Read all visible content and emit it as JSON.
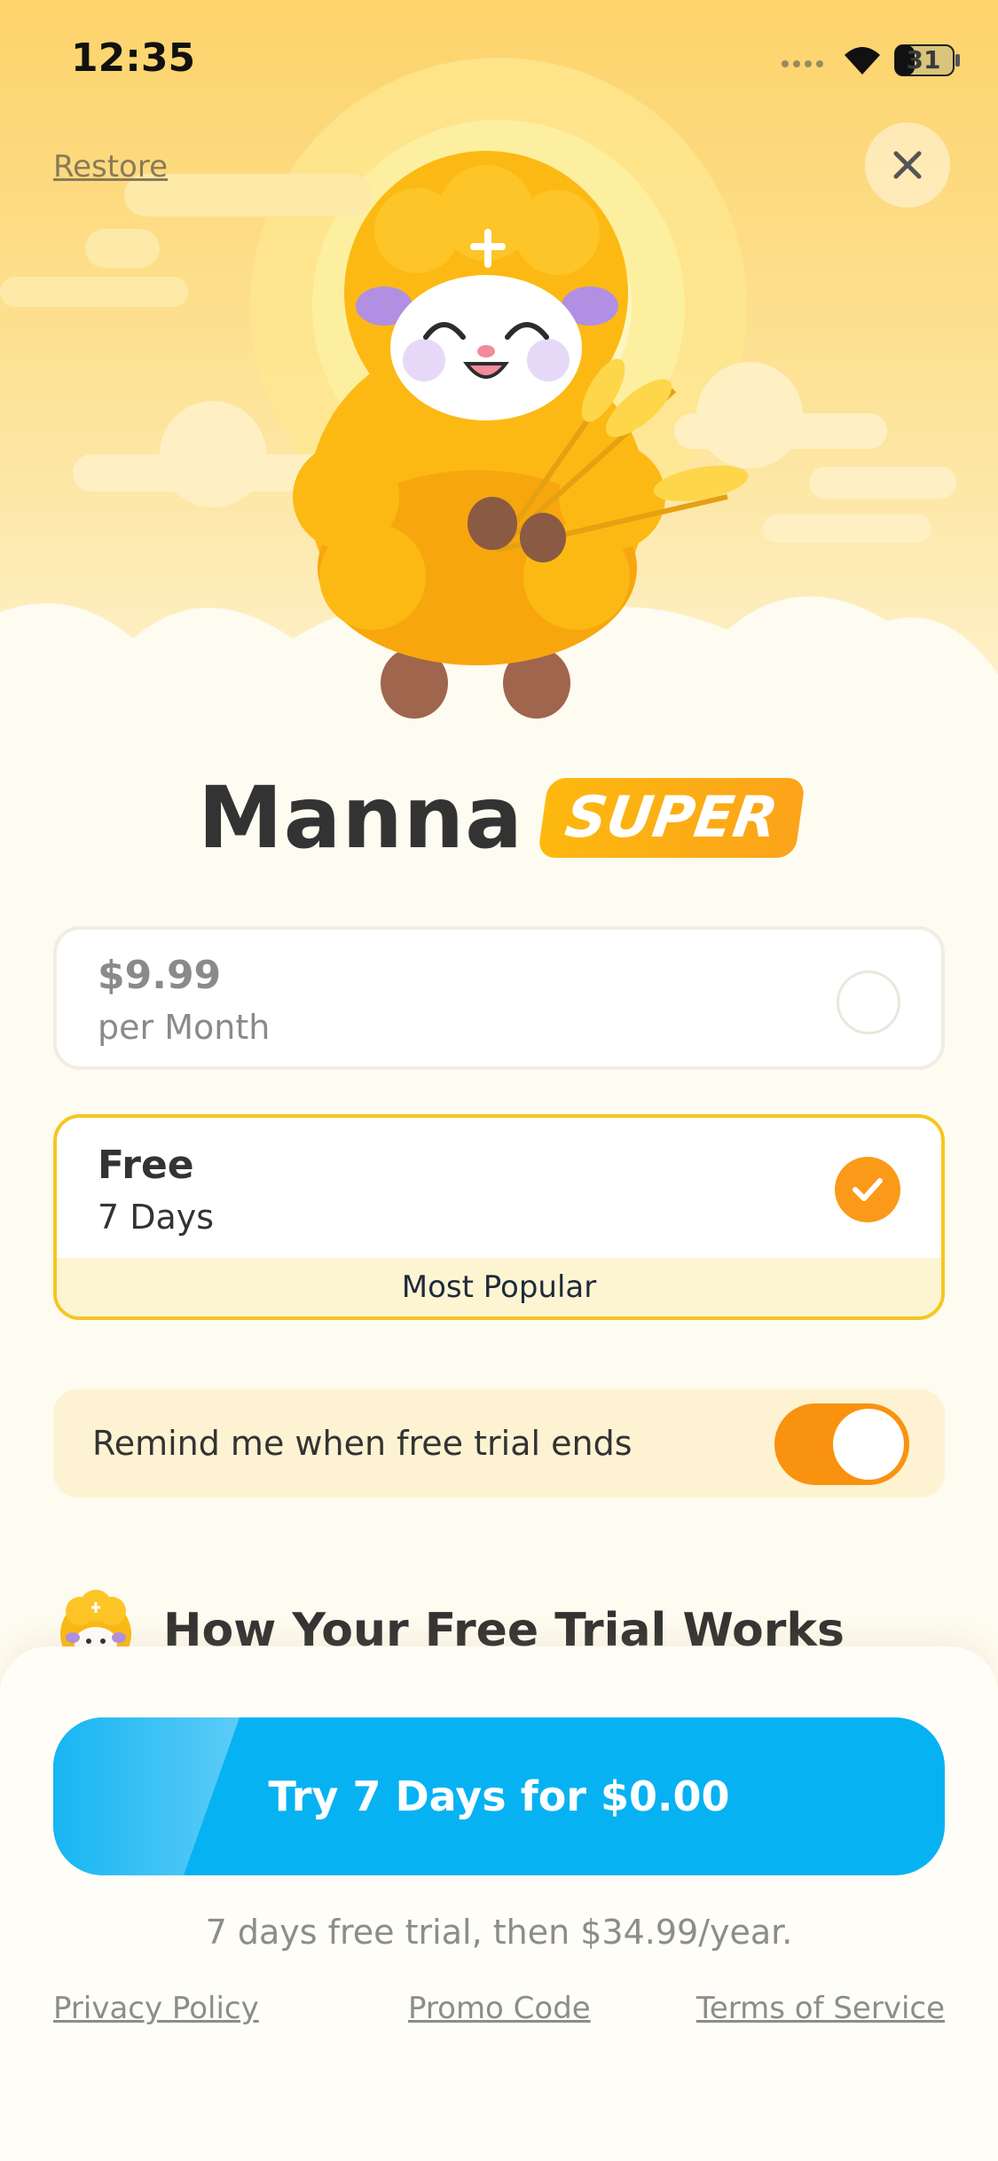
{
  "status_bar": {
    "time": "12:35",
    "battery": "31",
    "icons": [
      "signal-icon",
      "wifi-icon",
      "battery-icon"
    ]
  },
  "header": {
    "restore_label": "Restore",
    "close_icon": "close-icon"
  },
  "brand": {
    "app_name": "Manna",
    "badge": "SUPER",
    "accent": "#fcae14"
  },
  "plans": [
    {
      "price": "$9.99",
      "period": "per Month",
      "selected": false
    },
    {
      "price": "Free",
      "period": "7 Days",
      "selected": true,
      "tag": "Most Popular"
    }
  ],
  "reminder": {
    "label": "Remind me when free trial ends",
    "enabled": true
  },
  "how_it_works": {
    "title": "How Your Free Trial Works"
  },
  "cta": {
    "label": "Try 7 Days for $0.00",
    "color": "#07b2f2"
  },
  "trial_note": "7 days free trial, then $34.99/year.",
  "footer": {
    "privacy": "Privacy Policy",
    "promo": "Promo Code",
    "terms": "Terms of Service"
  }
}
